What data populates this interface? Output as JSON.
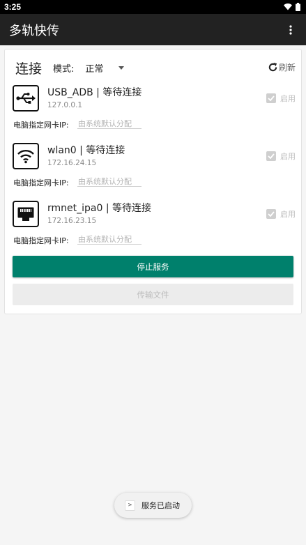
{
  "status_bar": {
    "time": "3:25"
  },
  "app_bar": {
    "title": "多轨快传"
  },
  "card": {
    "title": "连接",
    "mode_label": "模式:",
    "mode_value": "正常",
    "refresh_label": "刷新"
  },
  "devices": [
    {
      "icon": "usb-icon",
      "name": "USB_ADB | 等待连接",
      "ip": "127.0.0.1",
      "enable_label": "启用",
      "enabled": true,
      "nic_label": "电脑指定网卡IP:",
      "nic_placeholder": "由系统默认分配"
    },
    {
      "icon": "wifi-icon",
      "name": "wlan0 | 等待连接",
      "ip": "172.16.24.15",
      "enable_label": "启用",
      "enabled": true,
      "nic_label": "电脑指定网卡IP:",
      "nic_placeholder": "由系统默认分配"
    },
    {
      "icon": "ethernet-icon",
      "name": "rmnet_ipa0 | 等待连接",
      "ip": "172.16.23.15",
      "enable_label": "启用",
      "enabled": true,
      "nic_label": "电脑指定网卡IP:",
      "nic_placeholder": "由系统默认分配"
    }
  ],
  "buttons": {
    "stop": "停止服务",
    "transfer": "传输文件"
  },
  "toast": {
    "text": "服务已启动"
  },
  "colors": {
    "primary": "#00806c",
    "appbar": "#222222"
  }
}
